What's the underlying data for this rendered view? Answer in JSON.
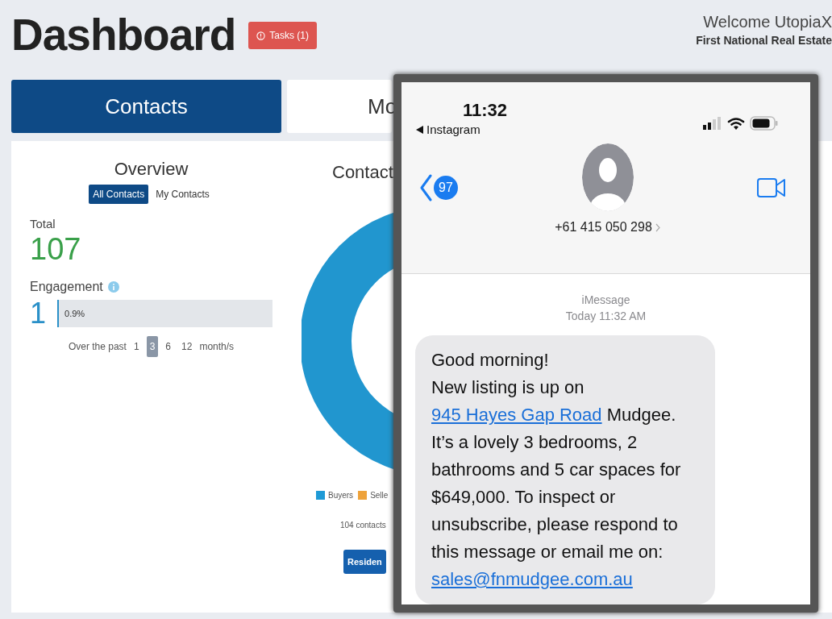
{
  "header": {
    "title": "Dashboard",
    "tasks_button": "Tasks (1)",
    "welcome": "Welcome UtopiaX",
    "company": "First National Real Estate"
  },
  "tabs": [
    {
      "label": "Contacts",
      "selected": true
    },
    {
      "label": "Mo",
      "selected": false
    }
  ],
  "overview": {
    "title": "Overview",
    "filters": [
      {
        "label": "All Contacts",
        "selected": true
      },
      {
        "label": "My Contacts",
        "selected": false
      }
    ],
    "total_label": "Total",
    "total": "107",
    "engagement_label": "Engagement",
    "engagement_count": "1",
    "engagement": {
      "level": 0.009,
      "reading": "0.9%"
    },
    "period_label": "Over the past",
    "periods": [
      {
        "label": "1",
        "selected": false
      },
      {
        "label": "3",
        "selected": true
      },
      {
        "label": "6",
        "selected": false
      },
      {
        "label": "12",
        "selected": false
      }
    ],
    "period_unit": "month/s"
  },
  "contacts_chart": {
    "title": "Contact",
    "legend": [
      {
        "label": "Buyers",
        "color": "#1e9ad6"
      },
      {
        "label": "Selle",
        "color": "#eea23a"
      }
    ],
    "summary": "104 contacts",
    "button": "Residen"
  },
  "phone": {
    "time": "11:32",
    "back_app": "Instagram",
    "unread_count": "97",
    "contact": "+61 415 050 298",
    "service": "iMessage",
    "timestamp": "Today 11:32 AM",
    "message": [
      {
        "kind": "text",
        "text": "Good morning!\nNew listing is up on "
      },
      {
        "kind": "link",
        "text": "945 Hayes Gap Road"
      },
      {
        "kind": "text",
        "text": " Mudgee. It’s a lovely 3 bedrooms, 2 bathrooms and 5 car spaces for $649,000. To inspect or unsubscribe, please respond to this message or email me on: "
      },
      {
        "kind": "link",
        "text": "sales@fnmudgee.com.au"
      }
    ]
  }
}
